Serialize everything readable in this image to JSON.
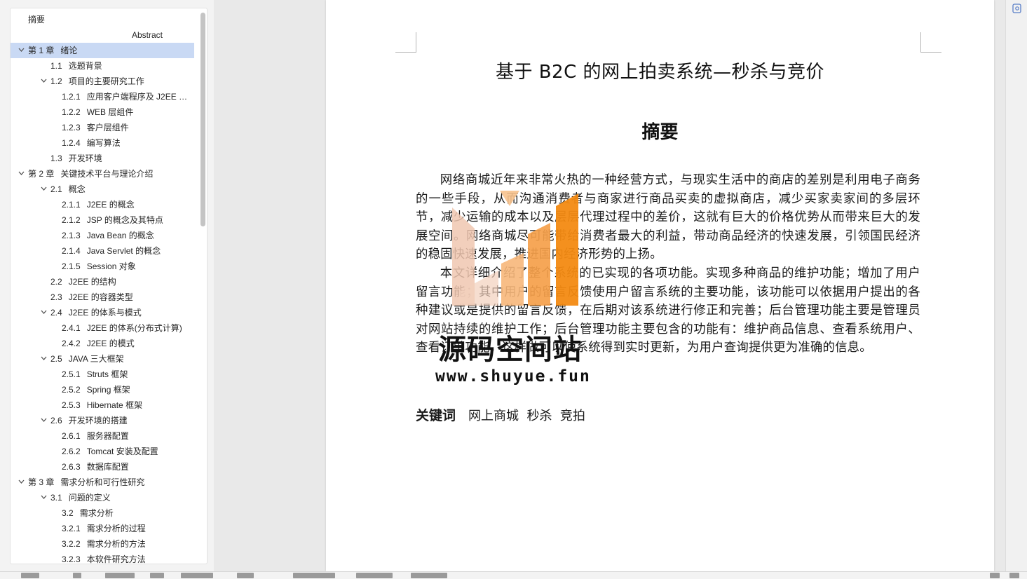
{
  "toc": [
    {
      "num": "",
      "text": "摘要",
      "level": 0,
      "chevron": false,
      "selected": false
    },
    {
      "num": "",
      "text": "Abstract",
      "level": 6,
      "chevron": false,
      "selected": false
    },
    {
      "num": "第 1 章",
      "text": "绪论",
      "level": 0,
      "chevron": true,
      "selected": true
    },
    {
      "num": "1.1",
      "text": "选题背景",
      "level": 1,
      "chevron": false,
      "selected": false
    },
    {
      "num": "1.2",
      "text": "项目的主要研究工作",
      "level": 1,
      "chevron": true,
      "selected": false
    },
    {
      "num": "1.2.1",
      "text": "应用客户端程序及 J2EE 服 ...",
      "level": 2,
      "chevron": false,
      "selected": false
    },
    {
      "num": "1.2.2",
      "text": "WEB 层组件",
      "level": 2,
      "chevron": false,
      "selected": false
    },
    {
      "num": "1.2.3",
      "text": "客户层组件",
      "level": 2,
      "chevron": false,
      "selected": false
    },
    {
      "num": "1.2.4",
      "text": "编写算法",
      "level": 2,
      "chevron": false,
      "selected": false
    },
    {
      "num": "1.3",
      "text": "开发环境",
      "level": 1,
      "chevron": false,
      "selected": false
    },
    {
      "num": "第 2 章",
      "text": "关键技术平台与理论介绍",
      "level": 0,
      "chevron": true,
      "selected": false
    },
    {
      "num": "2.1",
      "text": "概念",
      "level": 1,
      "chevron": true,
      "selected": false
    },
    {
      "num": "2.1.1",
      "text": "J2EE 的概念",
      "level": 2,
      "chevron": false,
      "selected": false
    },
    {
      "num": "2.1.2",
      "text": "JSP 的概念及其特点",
      "level": 2,
      "chevron": false,
      "selected": false
    },
    {
      "num": "2.1.3",
      "text": "Java Bean 的概念",
      "level": 2,
      "chevron": false,
      "selected": false
    },
    {
      "num": "2.1.4",
      "text": "Java Servlet 的概念",
      "level": 2,
      "chevron": false,
      "selected": false
    },
    {
      "num": "2.1.5",
      "text": "Session 对象",
      "level": 2,
      "chevron": false,
      "selected": false
    },
    {
      "num": "2.2",
      "text": "J2EE 的结构",
      "level": 1,
      "chevron": false,
      "selected": false
    },
    {
      "num": "2.3",
      "text": "J2EE 的容器类型",
      "level": 1,
      "chevron": false,
      "selected": false
    },
    {
      "num": "2.4",
      "text": "J2EE 的体系与模式",
      "level": 1,
      "chevron": true,
      "selected": false
    },
    {
      "num": "2.4.1",
      "text": "J2EE 的体系(分布式计算)",
      "level": 2,
      "chevron": false,
      "selected": false
    },
    {
      "num": "2.4.2",
      "text": "J2EE 的模式",
      "level": 2,
      "chevron": false,
      "selected": false
    },
    {
      "num": "2.5",
      "text": "JAVA 三大框架",
      "level": 1,
      "chevron": true,
      "selected": false
    },
    {
      "num": "2.5.1",
      "text": "Struts 框架",
      "level": 2,
      "chevron": false,
      "selected": false
    },
    {
      "num": "2.5.2",
      "text": "Spring 框架",
      "level": 2,
      "chevron": false,
      "selected": false
    },
    {
      "num": "2.5.3",
      "text": "Hibernate 框架",
      "level": 2,
      "chevron": false,
      "selected": false
    },
    {
      "num": "2.6",
      "text": "开发环境的搭建",
      "level": 1,
      "chevron": true,
      "selected": false
    },
    {
      "num": "2.6.1",
      "text": "服务器配置",
      "level": 2,
      "chevron": false,
      "selected": false
    },
    {
      "num": "2.6.2",
      "text": "Tomcat 安装及配置",
      "level": 2,
      "chevron": false,
      "selected": false
    },
    {
      "num": "2.6.3",
      "text": "数据库配置",
      "level": 2,
      "chevron": false,
      "selected": false
    },
    {
      "num": "第 3 章",
      "text": "需求分析和可行性研究",
      "level": 0,
      "chevron": true,
      "selected": false
    },
    {
      "num": "3.1",
      "text": "问题的定义",
      "level": 1,
      "chevron": true,
      "selected": false
    },
    {
      "num": "3.2",
      "text": "需求分析",
      "level": 2,
      "chevron": false,
      "selected": false
    },
    {
      "num": "3.2.1",
      "text": "需求分析的过程",
      "level": 2,
      "chevron": false,
      "selected": false
    },
    {
      "num": "3.2.2",
      "text": "需求分析的方法",
      "level": 2,
      "chevron": false,
      "selected": false
    },
    {
      "num": "3.2.3",
      "text": "本软件研究方法",
      "level": 2,
      "chevron": false,
      "selected": false
    }
  ],
  "document": {
    "title": "基于 B2C 的网上拍卖系统—秒杀与竞价",
    "abstract_heading": "摘要",
    "paragraphs": [
      "网络商城近年来非常火热的一种经营方式，与现实生活中的商店的差别是利用电子商务的一些手段，从而沟通消费者与商家进行商品买卖的虚拟商店，减少买家卖家间的多层环节，减少运输的成本以及层层代理过程中的差价，这就有巨大的价格优势从而带来巨大的发展空间。网络商城尽可能带给消费者最大的利益，带动商品经济的快速发展，引领国民经济的稳固快速发展，推进国内经济形势的上扬。",
      "本文详细介绍了整个系统的已实现的各项功能。实现多种商品的维护功能；增加了用户留言功能；其中用户的留言反馈使用户留言系统的主要功能，该功能可以依据用户提出的各种建议或是提供的留言反馈，在后期对该系统进行修正和完善；后台管理功能主要是管理员对网站持续的维护工作；后台管理功能主要包含的功能有：维护商品信息、查看系统用户、查看订单功能，这样做可以使系统得到实时更新，为用户查询提供更为准确的信息。"
    ],
    "keywords_label": "关键词",
    "keywords": "网上商城  秒杀  竞拍"
  },
  "watermark": {
    "name": "源码空间站",
    "url": "www.shuyue.fun"
  },
  "colors": {
    "selected_row": "#c9d9f4",
    "watermark_orange": "#f39322",
    "watermark_light": "#f7c28d"
  }
}
